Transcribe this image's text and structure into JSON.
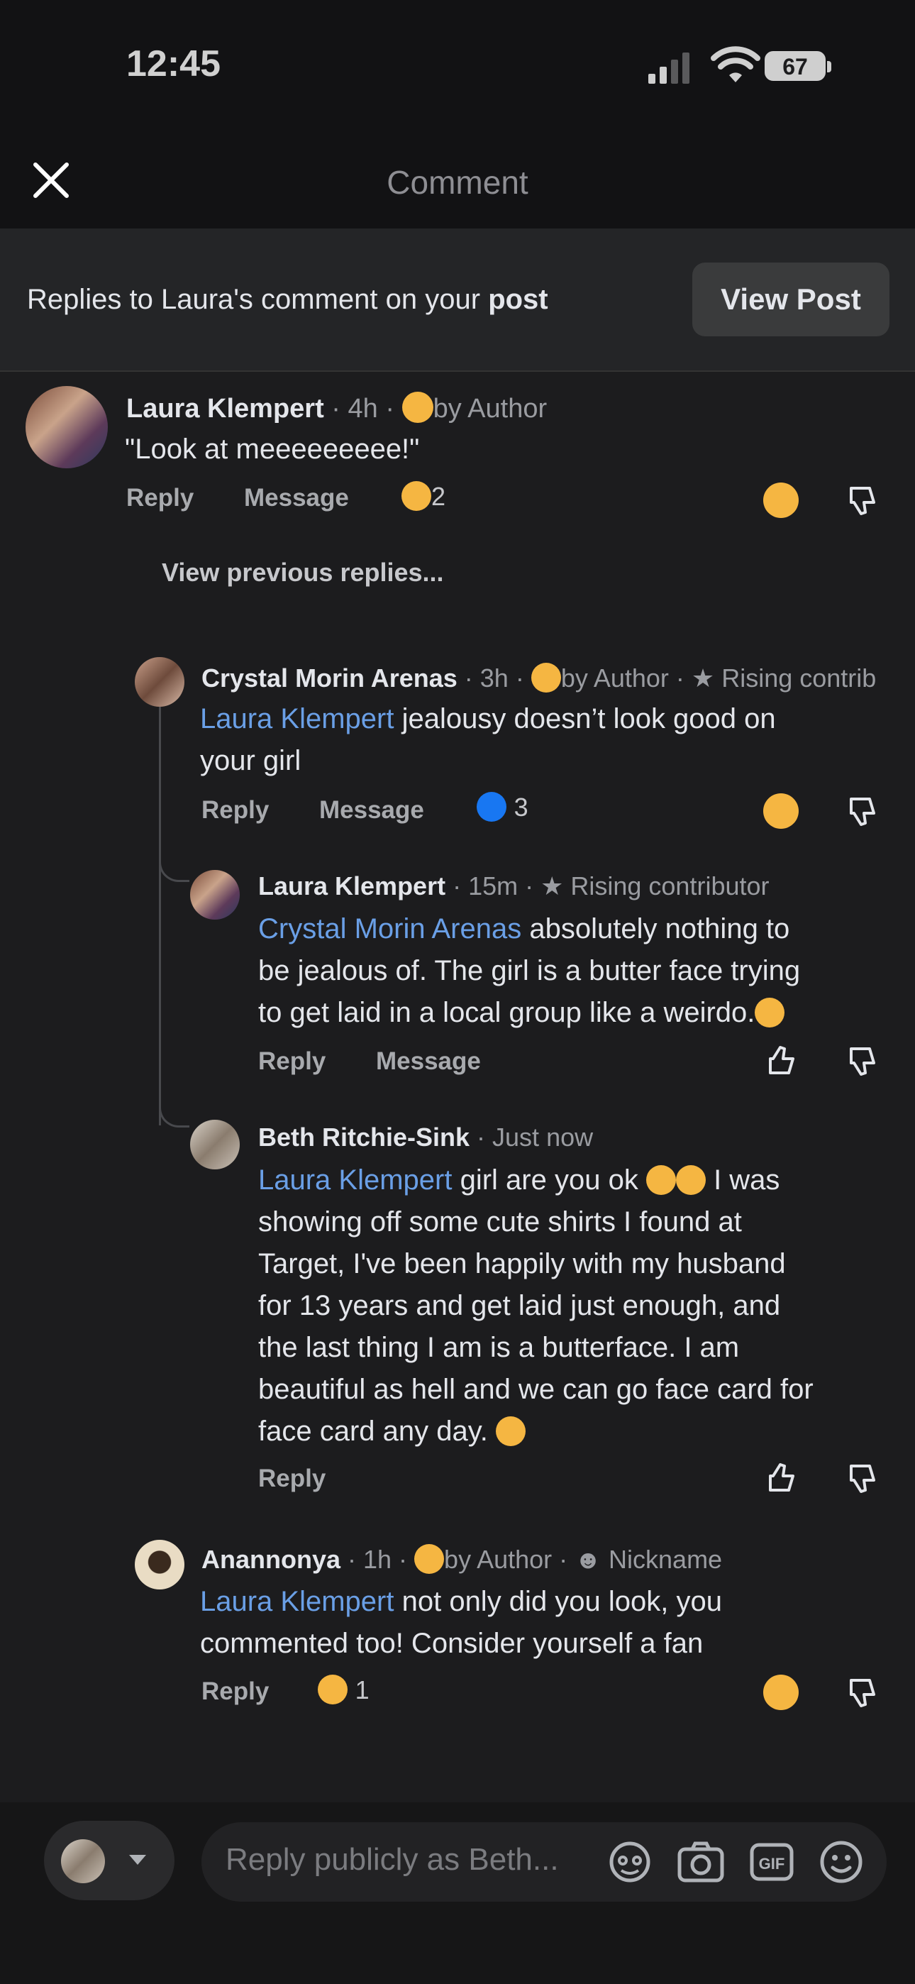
{
  "status": {
    "time": "12:45",
    "battery": "67"
  },
  "header": {
    "title": "Comment"
  },
  "banner": {
    "text_prefix": "Replies to Laura's comment on your ",
    "text_bold": "post",
    "view_post_label": "View Post"
  },
  "comments": [
    {
      "name": "Laura Klempert",
      "meta": " · 4h · ",
      "badge": "by Author",
      "text": "\"Look at meeeeeeeee!\"",
      "reply": "Reply",
      "message": "Message",
      "reaction_count": "2"
    },
    {
      "view_previous": "View previous replies..."
    },
    {
      "name": "Crystal Morin Arenas",
      "meta": " · 3h · ",
      "badge": "by Author",
      "badge2": "Rising contrib",
      "mention": "Laura Klempert",
      "line1": " jealousy doesn’t look good on",
      "line2": "your girl",
      "reply": "Reply",
      "message": "Message",
      "reaction_count": "3"
    },
    {
      "name": "Laura Klempert",
      "meta": " · 15m · ",
      "badge": "Rising contributor",
      "mention": "Crystal Morin Arenas",
      "line1": " absolutely nothing to",
      "line2": "be jealous of. The girl is a butter face trying",
      "line3": "to get laid in a local group like a weirdo.",
      "reply": "Reply",
      "message": "Message"
    },
    {
      "name": "Beth Ritchie-Sink",
      "meta": " · Just now",
      "mention": "Laura Klempert",
      "line1": " girl are you ok ",
      "line1b": " I was",
      "line2": "showing off some cute shirts I found at",
      "line3": "Target, I've been happily with my husband",
      "line4": "for 13 years and get laid just enough, and",
      "line5": "the last thing I am is a butterface. I am",
      "line6": "beautiful as hell and we can go face card for",
      "line7": "face card any day. ",
      "reply": "Reply"
    },
    {
      "name": "Anannonya",
      "meta": " · 1h · ",
      "badge": "by Author",
      "badge2": "Nickname",
      "mention": "Laura Klempert",
      "line1": " not only did you look, you",
      "line2": "commented too! Consider yourself a fan",
      "reply": "Reply",
      "reaction_count": "1"
    }
  ],
  "composer": {
    "placeholder": "Reply publicly as Beth..."
  }
}
